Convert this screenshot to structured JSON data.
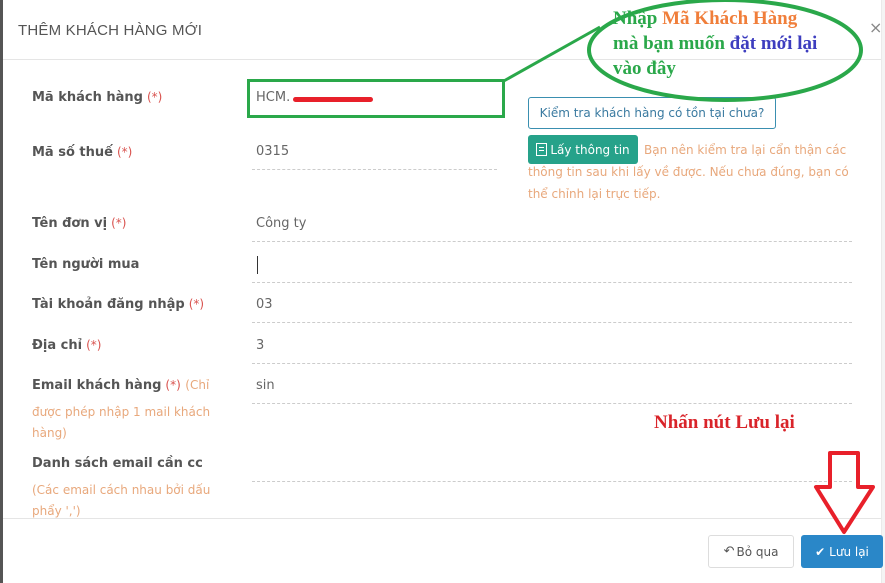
{
  "modal": {
    "title": "THÊM KHÁCH HÀNG MỚI",
    "close_symbol": "×"
  },
  "form": {
    "required_mark": "(*)",
    "fields": [
      {
        "label": "Mã khách hàng",
        "required": true,
        "value": "HCM."
      },
      {
        "label": "Mã số thuế",
        "required": true,
        "value": "0315"
      },
      {
        "label": "Tên đơn vị",
        "required": true,
        "value": "Công ty"
      },
      {
        "label": "Tên người mua",
        "required": false,
        "value": ""
      },
      {
        "label": "Tài khoản đăng nhập",
        "required": true,
        "value": "03"
      },
      {
        "label": "Địa chỉ",
        "required": true,
        "value": "3"
      },
      {
        "label": "Email khách hàng",
        "required": true,
        "hint_inline": "(Chỉ",
        "hint_rest": "được phép nhập 1 mail khách hàng)",
        "value": "sin"
      },
      {
        "label": "Danh sách email cần cc",
        "required": false,
        "hint": "(Các email cách nhau bởi dấu phẩy ',')",
        "value": ""
      }
    ],
    "check_button": "Kiểm tra khách hàng có tồn tại chưa?",
    "fetch_button": "Lấy thông tin",
    "fetch_note": "Bạn nên kiểm tra lại cẩn thận các thông tin sau khi lấy về được. Nếu chưa đúng, bạn có thể chỉnh lại trực tiếp."
  },
  "annotations": {
    "callout_part1": "Nhập ",
    "callout_part2": "Mã Khách Hàng",
    "callout_part3": "mà bạn muốn ",
    "callout_part4": "đặt mới lại",
    "callout_part5": "vào đây",
    "save_hint": "Nhấn nút Lưu lại",
    "colors": {
      "green": "#2aa84a",
      "orange": "#f07e3a",
      "blue": "#3d3dbf",
      "red": "#d9242a"
    }
  },
  "footer": {
    "cancel_label": "Bỏ qua",
    "save_label": "Lưu lại"
  }
}
